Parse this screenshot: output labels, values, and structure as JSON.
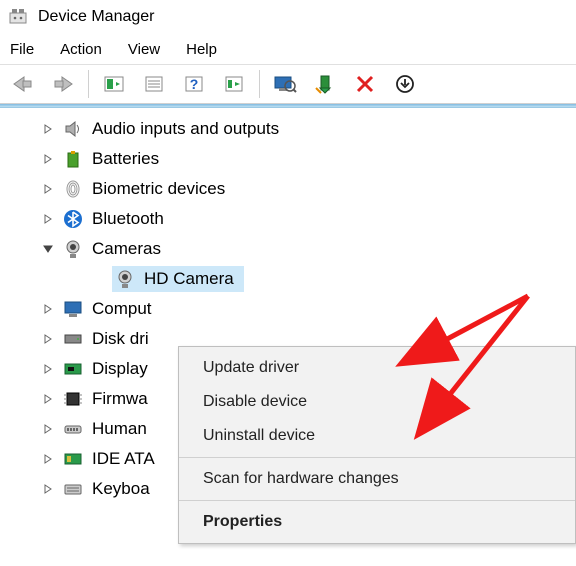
{
  "title": "Device Manager",
  "menubar": [
    "File",
    "Action",
    "View",
    "Help"
  ],
  "toolbar_icons": [
    "back-icon",
    "forward-icon",
    "show-hide-tree-icon",
    "properties-icon",
    "help-icon",
    "details-icon",
    "scan-icon",
    "update-driver-icon",
    "disable-icon",
    "uninstall-icon"
  ],
  "tree": {
    "items": [
      {
        "label": "Audio inputs and outputs",
        "expanded": false,
        "icon": "speaker-icon"
      },
      {
        "label": "Batteries",
        "expanded": false,
        "icon": "battery-icon"
      },
      {
        "label": "Biometric devices",
        "expanded": false,
        "icon": "fingerprint-icon"
      },
      {
        "label": "Bluetooth",
        "expanded": false,
        "icon": "bluetooth-icon"
      },
      {
        "label": "Cameras",
        "expanded": true,
        "icon": "camera-icon",
        "children": [
          {
            "label": "HD Camera",
            "icon": "camera-icon",
            "selected": true
          }
        ]
      },
      {
        "label": "Computers",
        "expanded": false,
        "icon": "monitor-icon",
        "truncated_label": "Comput"
      },
      {
        "label": "Disk drives",
        "expanded": false,
        "icon": "disk-icon",
        "truncated_label": "Disk dri"
      },
      {
        "label": "Display adapters",
        "expanded": false,
        "icon": "display-adapter-icon",
        "truncated_label": "Display"
      },
      {
        "label": "Firmware",
        "expanded": false,
        "icon": "firmware-icon",
        "truncated_label": "Firmwa"
      },
      {
        "label": "Human Interface Devices",
        "expanded": false,
        "icon": "hid-icon",
        "truncated_label": "Human"
      },
      {
        "label": "IDE ATA/ATAPI controllers",
        "expanded": false,
        "icon": "ide-icon",
        "truncated_label": "IDE ATA"
      },
      {
        "label": "Keyboards",
        "expanded": false,
        "icon": "keyboard-icon",
        "truncated_label": "Keyboa"
      }
    ]
  },
  "context_menu": {
    "items": [
      {
        "label": "Update driver",
        "type": "item"
      },
      {
        "label": "Disable device",
        "type": "item"
      },
      {
        "label": "Uninstall device",
        "type": "item"
      },
      {
        "type": "sep"
      },
      {
        "label": "Scan for hardware changes",
        "type": "item"
      },
      {
        "type": "sep"
      },
      {
        "label": "Properties",
        "type": "item",
        "bold": true
      }
    ]
  }
}
